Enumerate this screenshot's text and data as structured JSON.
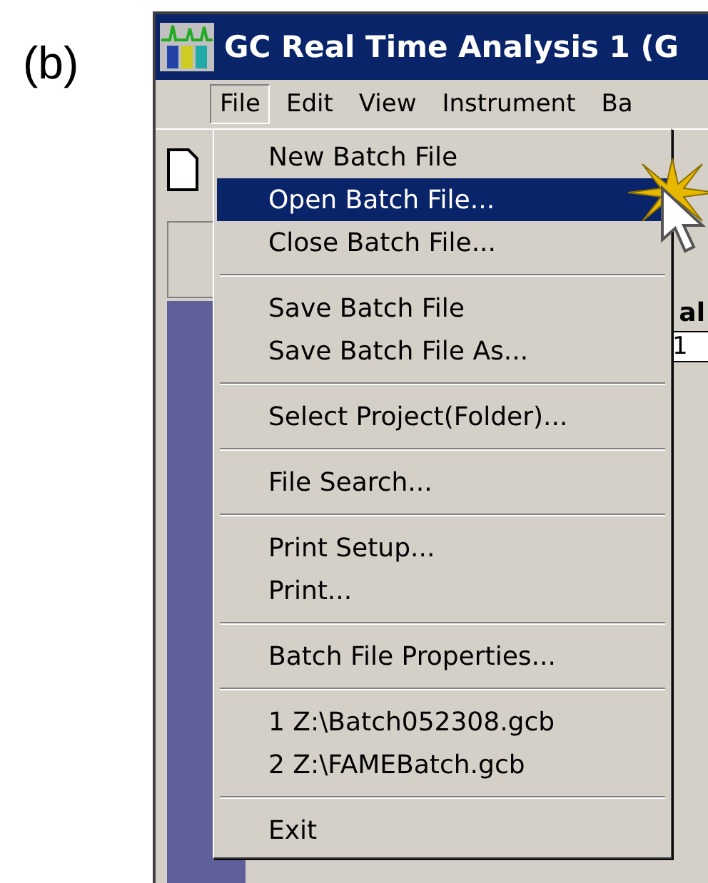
{
  "figure_label": "(b)",
  "window": {
    "title": "GC Real Time Analysis 1 (G"
  },
  "menu_bar": [
    {
      "label": "File",
      "selected": true
    },
    {
      "label": "Edit",
      "selected": false
    },
    {
      "label": "View",
      "selected": false
    },
    {
      "label": "Instrument",
      "selected": false
    },
    {
      "label": "Ba",
      "selected": false
    }
  ],
  "file_menu": [
    {
      "kind": "item",
      "label": "New Batch File",
      "selected": false
    },
    {
      "kind": "item",
      "label": "Open Batch File...",
      "selected": true
    },
    {
      "kind": "item",
      "label": "Close Batch File...",
      "selected": false
    },
    {
      "kind": "separator"
    },
    {
      "kind": "item",
      "label": "Save Batch File",
      "selected": false
    },
    {
      "kind": "item",
      "label": "Save Batch File As...",
      "selected": false
    },
    {
      "kind": "separator"
    },
    {
      "kind": "item",
      "label": "Select Project(Folder)...",
      "selected": false
    },
    {
      "kind": "separator"
    },
    {
      "kind": "item",
      "label": "File Search...",
      "selected": false
    },
    {
      "kind": "separator"
    },
    {
      "kind": "item",
      "label": "Print Setup...",
      "selected": false
    },
    {
      "kind": "item",
      "label": "Print...",
      "selected": false
    },
    {
      "kind": "separator"
    },
    {
      "kind": "item",
      "label": "Batch File Properties...",
      "selected": false
    },
    {
      "kind": "separator"
    },
    {
      "kind": "item",
      "label": "1 Z:\\Batch052308.gcb",
      "selected": false
    },
    {
      "kind": "item",
      "label": "2 Z:\\FAMEBatch.gcb",
      "selected": false
    },
    {
      "kind": "separator"
    },
    {
      "kind": "item",
      "label": "Exit",
      "selected": false
    }
  ],
  "background_table": {
    "column_header": "al",
    "cell": "1"
  }
}
